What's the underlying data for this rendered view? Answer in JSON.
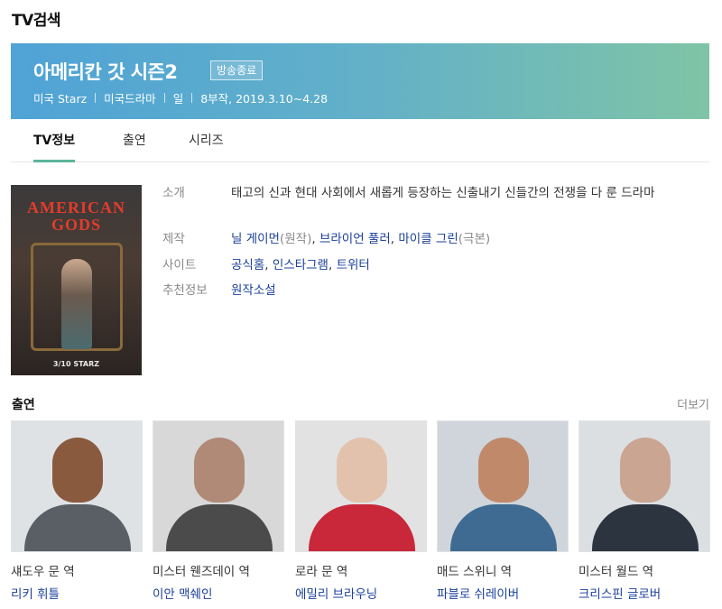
{
  "page": {
    "section_title": "TV검색"
  },
  "show": {
    "title": "아메리칸 갓 시즌2",
    "status": "방송종료",
    "meta": [
      "미국 Starz",
      "미국드라마",
      "일",
      "8부작, 2019.3.10~4.28"
    ]
  },
  "tabs": [
    {
      "label": "TV정보",
      "active": true
    },
    {
      "label": "출연",
      "active": false
    },
    {
      "label": "시리즈",
      "active": false
    }
  ],
  "poster": {
    "title_line1": "AMERICAN",
    "title_line2": "GODS",
    "footer": "3/10 STARZ"
  },
  "info": {
    "intro": {
      "label": "소개",
      "value": "태고의 신과 현대 사회에서 새롭게 등장하는 신출내기 신들간의 전쟁을 다 룬 드라마"
    },
    "production": {
      "label": "제작",
      "items": [
        {
          "name": "닐 게이먼",
          "role": "(원작)"
        },
        {
          "name": "브라이언 풀러",
          "role": ""
        },
        {
          "name": "마이클 그린",
          "role": "(극본)"
        }
      ]
    },
    "site": {
      "label": "사이트",
      "links": [
        "공식홈",
        "인스타그램",
        "트위터"
      ]
    },
    "recommend": {
      "label": "추천정보",
      "value": "원작소설"
    }
  },
  "cast": {
    "title": "출연",
    "more": "더보기",
    "members": [
      {
        "role": "섀도우 문 역",
        "actor": "리키 휘틀",
        "skin": "#8a5a3f",
        "cloth": "#5a5f66",
        "bg": "#dfe2e5"
      },
      {
        "role": "미스터 웬즈데이 역",
        "actor": "이안 맥쉐인",
        "skin": "#b08a77",
        "cloth": "#4b4b4b",
        "bg": "#d8d8d8"
      },
      {
        "role": "로라 문 역",
        "actor": "에밀리 브라우닝",
        "skin": "#e3c2ad",
        "cloth": "#c8283a",
        "bg": "#e2e2e2"
      },
      {
        "role": "매드 스위니 역",
        "actor": "파블로 쉬레이버",
        "skin": "#c08a6a",
        "cloth": "#3f6b93",
        "bg": "#cfd5da"
      },
      {
        "role": "미스터 월드 역",
        "actor": "크리스핀 글로버",
        "skin": "#caa592",
        "cloth": "#2c3440",
        "bg": "#dcdfe2"
      }
    ]
  }
}
